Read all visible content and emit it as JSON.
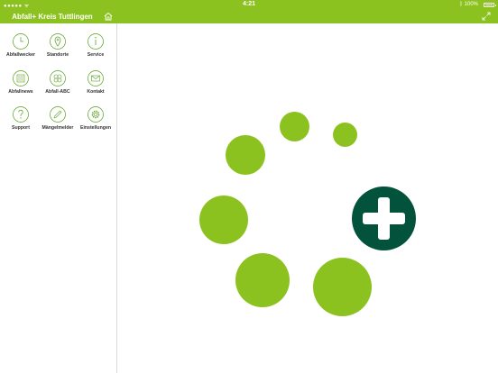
{
  "status_bar": {
    "signal": "●●●●● ᯤ",
    "time": "4:21",
    "battery_text": "ᛒ 100%"
  },
  "header": {
    "title": "Abfall+ Kreis Tuttlingen"
  },
  "menu": [
    {
      "label": "Abfallwecker",
      "icon": "alarm-clock-icon"
    },
    {
      "label": "Standorte",
      "icon": "location-pin-icon"
    },
    {
      "label": "Service",
      "icon": "info-icon"
    },
    {
      "label": "Abfallnews",
      "icon": "news-icon"
    },
    {
      "label": "Abfall-ABC",
      "icon": "abc-icon"
    },
    {
      "label": "Kontakt",
      "icon": "envelope-icon"
    },
    {
      "label": "Support",
      "icon": "question-icon"
    },
    {
      "label": "Mängelmelder",
      "icon": "pencil-icon"
    },
    {
      "label": "Einstellungen",
      "icon": "gear-icon"
    }
  ],
  "colors": {
    "brand_green": "#8cc21f",
    "dark_green": "#03523c",
    "icon_stroke": "#5aa020"
  }
}
